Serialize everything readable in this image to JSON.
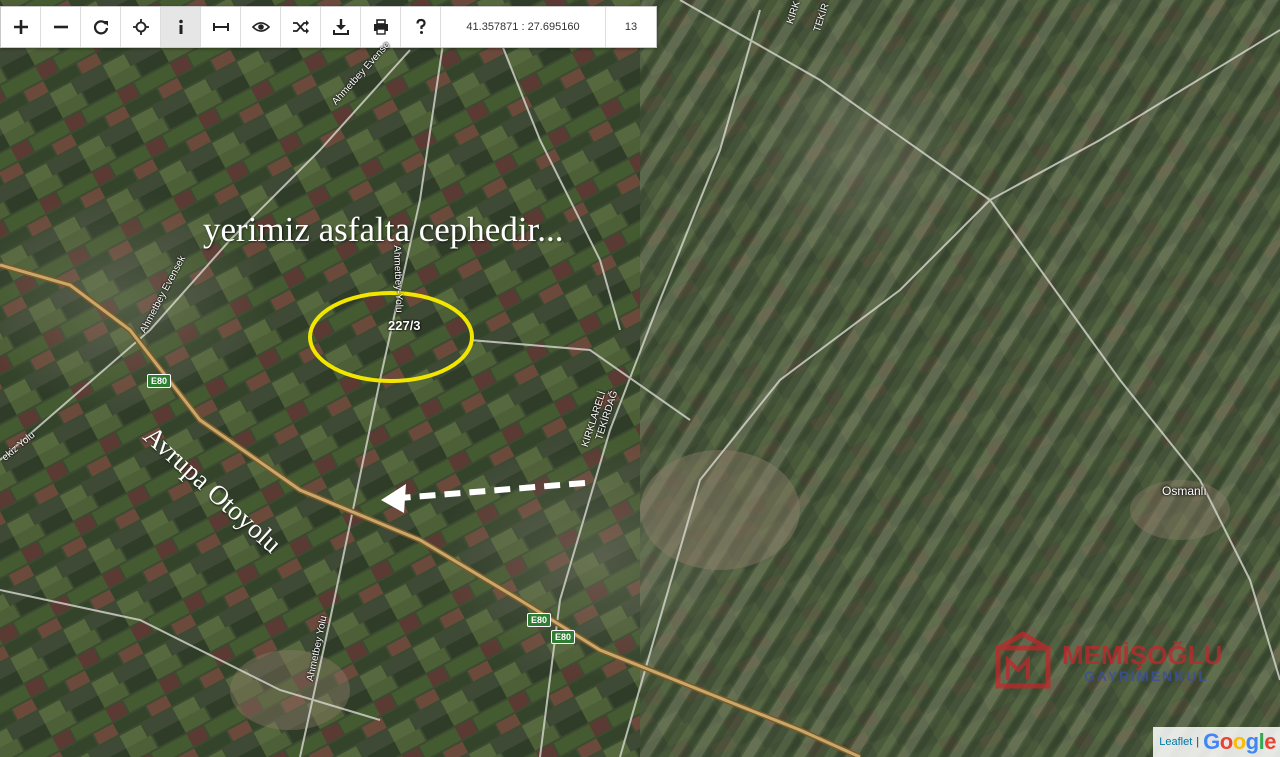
{
  "toolbar": {
    "coords": "41.357871 : 27.695160",
    "zoom": "13"
  },
  "overlay": {
    "caption": "yerimiz asfalta cephedir...",
    "motorway": "Avrupa Otoyolu",
    "parcel": "227/3"
  },
  "roads": {
    "r1": "Ahmetbey Evense",
    "r2": "Ahmetbey Evensek",
    "r3": "Ahmetbey-Yolu",
    "r4": "Ahmetbey Yolu",
    "r5": "ekiz Yolu",
    "r6": "KIRKLARELİ",
    "r7": "TEKİRDAĞ",
    "r8": "KIRK",
    "r9": "TEKİR"
  },
  "shields": {
    "e80": "E80"
  },
  "places": {
    "osmanli": "Osmanlı"
  },
  "attribution": {
    "leaflet": "Leaflet",
    "separator": "|",
    "google": "Google"
  },
  "watermark": {
    "name": "MEMİŞOĞLU",
    "sub": "GAYRİMENKUL"
  },
  "colors": {
    "ellipse": "#f2e600",
    "arrow": "#ffffff",
    "motorway": "#c9a86b",
    "brand": "#c0282b"
  }
}
